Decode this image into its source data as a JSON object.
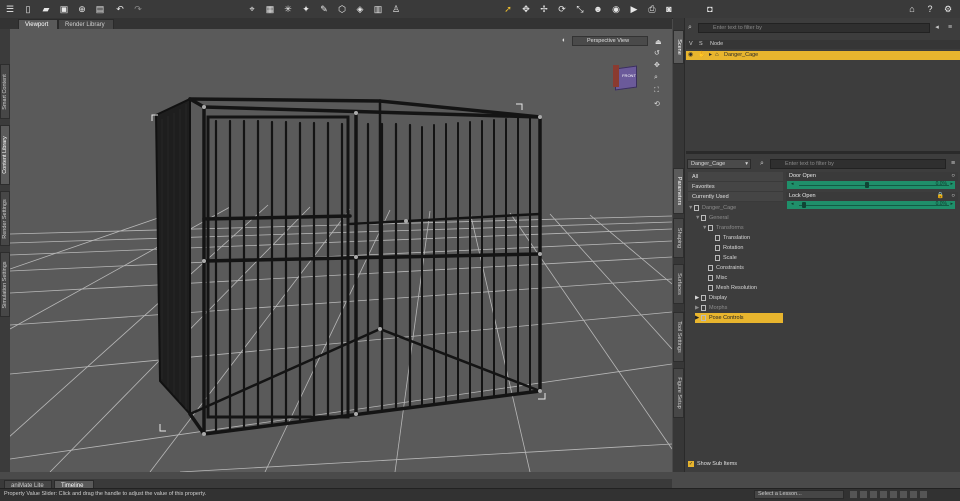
{
  "colors": {
    "accent": "#f0c030",
    "slider": "#1f8f6a",
    "selected_row": "#e8b52e",
    "grid": "#c8c8c8",
    "cage": "#1a1a1a"
  },
  "toolbar": {
    "left_icons": [
      "menu-icon",
      "new-file-icon",
      "open-file-icon",
      "save-icon",
      "merge-icon",
      "render-settings-icon",
      "undo-icon",
      "redo-icon"
    ],
    "center_icons": [
      "node-select-icon",
      "region-select-icon",
      "joint-editor-icon",
      "pose-tool-icon",
      "surface-selection-icon",
      "geometry-editor-icon",
      "spot-render-icon",
      "figure-setup-icon",
      "transform-tool-icon"
    ],
    "main_icons": [
      "pointer-icon",
      "universal-tool-icon",
      "translate-icon",
      "rotate-icon",
      "scale-icon",
      "active-pose-icon",
      "camera-view-icon",
      "render-icon",
      "screenshot-icon"
    ],
    "right_icons": [
      "home-icon",
      "help-icon"
    ]
  },
  "tabs": [
    {
      "label": "Viewport",
      "active": true
    },
    {
      "label": "Render Library",
      "active": false
    }
  ],
  "left_tabs": [
    "Smart Content",
    "Content Library",
    "Render Settings",
    "Simulation Settings"
  ],
  "viewport": {
    "view_label": "Perspective View",
    "cube_label": "FRONT"
  },
  "scene": {
    "filter_placeholder": "Enter text to filter by",
    "columns": {
      "visibility": "V",
      "selectable": "S",
      "node": "Node"
    },
    "node": "Danger_Cage"
  },
  "right_tabs": [
    "Scene",
    "Parameters",
    "Shaping",
    "Surfaces",
    "Tool Settings",
    "Figure Setup"
  ],
  "params": {
    "node_select": "Danger_Cage",
    "filter_placeholder": "Enter text to filter by",
    "categories": [
      "All",
      "Favorites",
      "Currently Used"
    ],
    "tree": [
      {
        "label": "Danger_Cage",
        "indent": 0,
        "dim": true,
        "arrow": "▼"
      },
      {
        "label": "General",
        "indent": 1,
        "dim": true,
        "arrow": "▼"
      },
      {
        "label": "Transforms",
        "indent": 2,
        "dim": true,
        "arrow": "▼"
      },
      {
        "label": "Translation",
        "indent": 3,
        "dim": false,
        "arrow": ""
      },
      {
        "label": "Rotation",
        "indent": 3,
        "dim": false,
        "arrow": ""
      },
      {
        "label": "Scale",
        "indent": 3,
        "dim": false,
        "arrow": ""
      },
      {
        "label": "Constraints",
        "indent": 2,
        "dim": false,
        "arrow": ""
      },
      {
        "label": "Misc",
        "indent": 2,
        "dim": false,
        "arrow": ""
      },
      {
        "label": "Mesh Resolution",
        "indent": 2,
        "dim": false,
        "arrow": ""
      },
      {
        "label": "Display",
        "indent": 1,
        "dim": false,
        "arrow": "▶"
      },
      {
        "label": "Morphs",
        "indent": 1,
        "dim": true,
        "arrow": "▶"
      },
      {
        "label": "Pose Controls",
        "indent": 1,
        "dim": false,
        "arrow": "▶",
        "selected": true
      }
    ],
    "sliders": [
      {
        "label": "Door Open",
        "value": "0.0%",
        "fraction": 0.45
      },
      {
        "label": "Lock Open",
        "value": "0.0%",
        "fraction": 0.02
      }
    ],
    "show_sub_items": "Show Sub Items"
  },
  "bottom_tabs": [
    {
      "label": "aniMate Lite",
      "active": false
    },
    {
      "label": "Timeline",
      "active": true
    }
  ],
  "status": {
    "text": "Property Value Slider: Click and drag the handle to adjust the value of this property.",
    "lesson": "Select a Lesson..."
  }
}
